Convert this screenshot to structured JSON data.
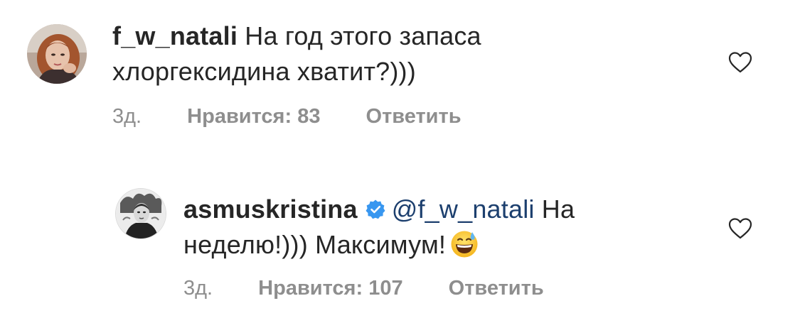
{
  "comments": [
    {
      "username": "f_w_natali",
      "text_line1": "На год этого запаса",
      "text_line2": "хлоргексидина хватит?)))",
      "time": "3д.",
      "likes": "Нравится: 83",
      "reply": "Ответить",
      "avatar": "user-avatar-woman",
      "verified": false
    },
    {
      "username": "asmuskristina",
      "mention": "@f_w_natali",
      "text_line1_suffix": "На",
      "text_line2": "неделю!))) Максимум!",
      "emoji": "grinning-face-with-sweat",
      "time": "3д.",
      "likes": "Нравится: 107",
      "reply": "Ответить",
      "avatar": "user-avatar-bw-portrait",
      "verified": true
    }
  ],
  "icons": {
    "like": "heart-outline-icon",
    "verified": "verified-badge-icon"
  },
  "colors": {
    "text": "#262626",
    "meta": "#8e8e8e",
    "mention": "#1c3f6e",
    "verified": "#3897f0"
  }
}
